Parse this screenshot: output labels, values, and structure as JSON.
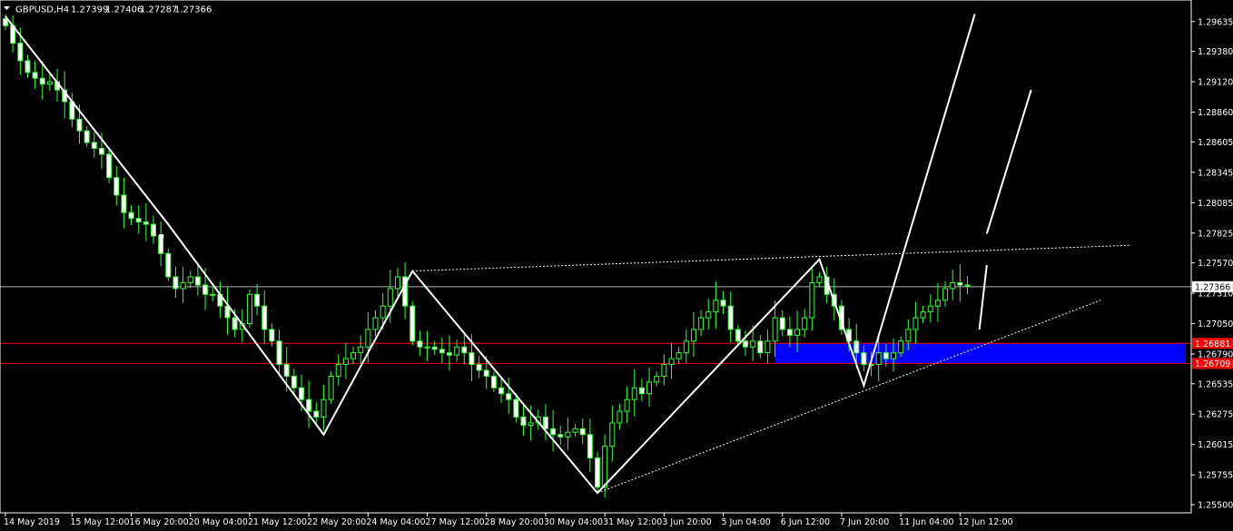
{
  "header": {
    "symbol": "GBPUSD,H4",
    "open": "1.27399",
    "high": "1.27406",
    "low": "1.27287",
    "close": "1.27366"
  },
  "colors": {
    "background": "#000000",
    "axis": "#ffffff",
    "bull_body": "#000000",
    "bear_body": "#ffffff",
    "wick": "#33ff33",
    "resistance_line": "#ff0000",
    "zone": "#0000ff",
    "price_line": "#ffffff",
    "pattern_line": "#ffffff"
  },
  "chart_data": {
    "type": "candlestick",
    "title": "GBPUSD,H4",
    "ylim": [
      1.2543,
      1.2982
    ],
    "y_ticks": [
      "1.29635",
      "1.29380",
      "1.29120",
      "1.28860",
      "1.28605",
      "1.28345",
      "1.28085",
      "1.27825",
      "1.27570",
      "1.27310",
      "1.27050",
      "1.26790",
      "1.26535",
      "1.26275",
      "1.26015",
      "1.25755",
      "1.25500"
    ],
    "x_ticks": [
      {
        "label": "14 May 2019",
        "index": 0
      },
      {
        "label": "15 May 12:00",
        "index": 9
      },
      {
        "label": "16 May 20:00",
        "index": 17
      },
      {
        "label": "20 May 04:00",
        "index": 25
      },
      {
        "label": "21 May 12:00",
        "index": 33
      },
      {
        "label": "22 May 20:00",
        "index": 41
      },
      {
        "label": "24 May 04:00",
        "index": 49
      },
      {
        "label": "27 May 12:00",
        "index": 57
      },
      {
        "label": "28 May 20:00",
        "index": 65
      },
      {
        "label": "30 May 04:00",
        "index": 73
      },
      {
        "label": "31 May 12:00",
        "index": 81
      },
      {
        "label": "3 Jun 20:00",
        "index": 89
      },
      {
        "label": "5 Jun 04:00",
        "index": 97
      },
      {
        "label": "6 Jun 12:00",
        "index": 105
      },
      {
        "label": "7 Jun 20:00",
        "index": 113
      },
      {
        "label": "11 Jun 04:00",
        "index": 121
      },
      {
        "label": "12 Jun 12:00",
        "index": 129
      }
    ],
    "closes": [
      1.296,
      1.2945,
      1.293,
      1.292,
      1.2915,
      1.291,
      1.2912,
      1.2905,
      1.2895,
      1.288,
      1.287,
      1.286,
      1.2855,
      1.285,
      1.283,
      1.2815,
      1.28,
      1.2795,
      1.2792,
      1.279,
      1.278,
      1.2765,
      1.2745,
      1.2735,
      1.274,
      1.2745,
      1.2738,
      1.273,
      1.273,
      1.272,
      1.271,
      1.27,
      1.2705,
      1.273,
      1.272,
      1.27,
      1.269,
      1.267,
      1.266,
      1.265,
      1.264,
      1.263,
      1.2625,
      1.264,
      1.266,
      1.267,
      1.2675,
      1.268,
      1.2685,
      1.27,
      1.271,
      1.272,
      1.2735,
      1.2745,
      1.272,
      1.269,
      1.2685,
      1.2685,
      1.2683,
      1.268,
      1.2678,
      1.2685,
      1.268,
      1.267,
      1.2665,
      1.266,
      1.265,
      1.2645,
      1.264,
      1.2625,
      1.2618,
      1.262,
      1.2625,
      1.2615,
      1.261,
      1.2608,
      1.2612,
      1.2615,
      1.261,
      1.259,
      1.2565,
      1.26,
      1.262,
      1.263,
      1.264,
      1.265,
      1.2645,
      1.2655,
      1.266,
      1.267,
      1.2675,
      1.268,
      1.269,
      1.27,
      1.271,
      1.2715,
      1.2725,
      1.272,
      1.27,
      1.269,
      1.2685,
      1.269,
      1.268,
      1.269,
      1.271,
      1.27,
      1.2695,
      1.27,
      1.271,
      1.274,
      1.2745,
      1.273,
      1.272,
      1.27,
      1.269,
      1.268,
      1.267,
      1.267,
      1.268,
      1.2675,
      1.268,
      1.269,
      1.27,
      1.271,
      1.2715,
      1.272,
      1.2725,
      1.2735,
      1.274,
      1.2738,
      1.2737
    ],
    "levels": {
      "upper": 1.26881,
      "lower": 1.26709,
      "upper_label": "1.26881",
      "lower_label": "1.26709",
      "current": 1.27366,
      "current_label": "1.27366"
    },
    "zone": {
      "from_index": 104,
      "to_index": "end",
      "top": 1.26881,
      "bottom": 1.26709
    },
    "zigzag": [
      {
        "index": 0,
        "price": 1.2968
      },
      {
        "index": 22,
        "price": 1.279
      },
      {
        "index": 43,
        "price": 1.261
      },
      {
        "index": 55,
        "price": 1.275
      },
      {
        "index": 80,
        "price": 1.256
      },
      {
        "index": 110,
        "price": 1.276
      },
      {
        "index": 116,
        "price": 1.2652
      },
      {
        "index": 131,
        "price": 1.297
      }
    ],
    "projection_path": [
      {
        "index": 131,
        "price": 1.27
      },
      {
        "index": 132,
        "price": 1.2755
      },
      {
        "index": 132,
        "price": 1.2782
      },
      {
        "index": 138,
        "price": 1.2905
      }
    ],
    "dotted_lines": [
      {
        "from": {
          "index": 55,
          "price": 1.275
        },
        "to": {
          "index": 152,
          "price": 1.2772
        }
      },
      {
        "from": {
          "index": 80,
          "price": 1.256
        },
        "to": {
          "index": 148,
          "price": 1.2725
        }
      }
    ]
  }
}
